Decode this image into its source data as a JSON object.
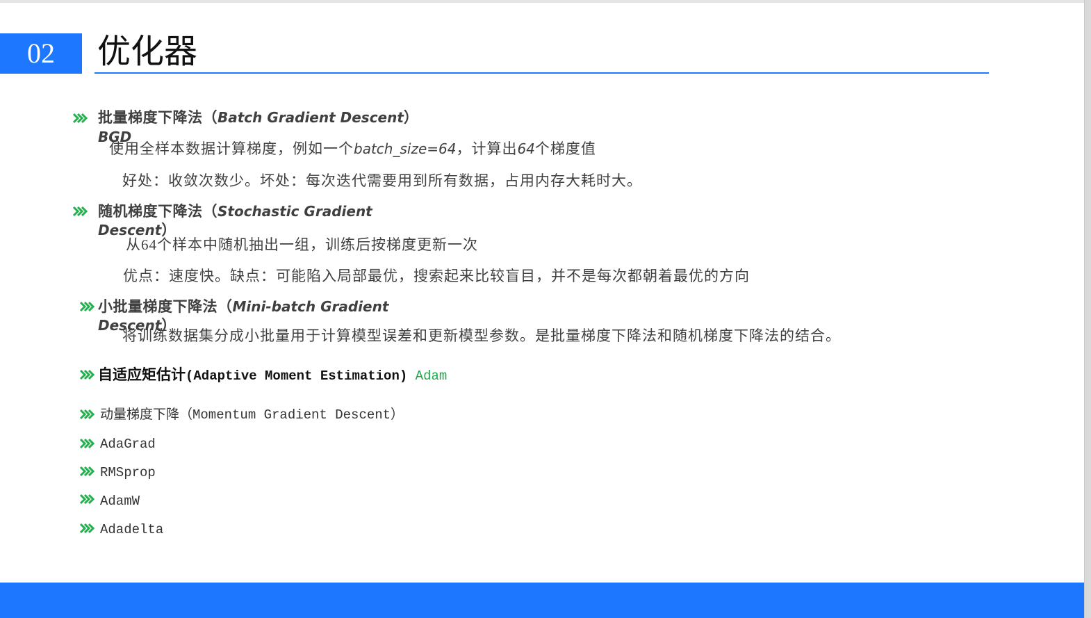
{
  "slide": {
    "number": "02",
    "title": "优化器"
  },
  "bgd": {
    "heading": {
      "zh": "批量梯度下降法（",
      "en": "Batch Gradient Descent",
      "close": "）",
      "abbr": "BGD"
    },
    "desc": [
      "使用全样本数据计算梯度，例如一个",
      "batch_size=64",
      "，计算出",
      "64",
      "个梯度值"
    ],
    "note": "好处：收敛次数少。坏处：每次迭代需要用到所有数据，占用内存大耗时大。"
  },
  "sgd": {
    "heading": {
      "zh": "随机梯度下降法（",
      "en_line1": "Stochastic Gradient",
      "en_line2": "Descent",
      "close": "）"
    },
    "desc": "从64个样本中随机抽出一组，训练后按梯度更新一次",
    "note": "优点：速度快。缺点：可能陷入局部最优，搜索起来比较盲目，并不是每次都朝着最优的方向"
  },
  "mbgd": {
    "heading": {
      "zh": "小批量梯度下降法（",
      "en_line1": "Mini-batch Gradient",
      "en_line2": "Descent",
      "close": "）"
    },
    "desc": "将训练数据集分成小批量用于计算模型误差和更新模型参数。是批量梯度下降法和随机梯度下降法的结合。"
  },
  "adam": {
    "zh": "自适应矩估计",
    "en": "(Adaptive Moment Estimation)",
    "abbr": "Adam"
  },
  "optimizers": [
    "动量梯度下降（Momentum Gradient Descent）",
    "AdaGrad",
    "RMSprop",
    "AdamW",
    "Adadelta"
  ],
  "icons": {
    "bullet": "triple-chevron-icon"
  },
  "colors": {
    "accent": "#1E78FF",
    "bullet": "#22B14C",
    "highlight": "#1FA84A",
    "text": "#404040",
    "title": "#111111"
  }
}
